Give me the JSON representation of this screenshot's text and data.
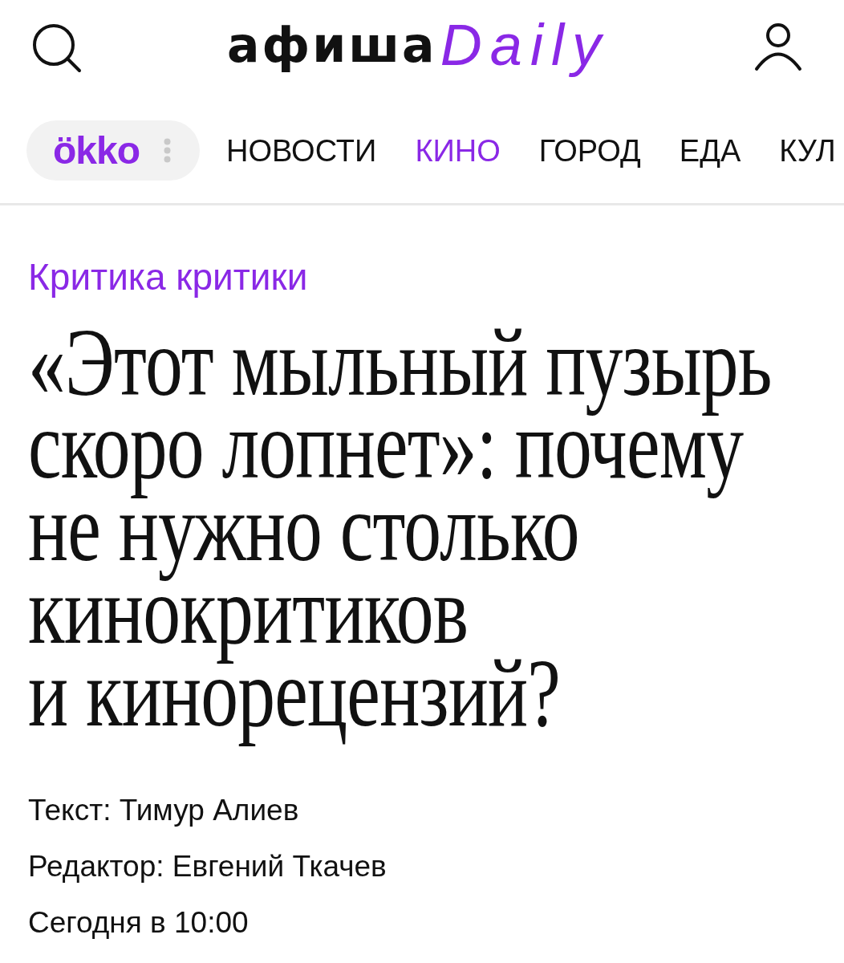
{
  "header": {
    "logo": {
      "wordmark": "афиша",
      "script": "Daily"
    }
  },
  "nav": {
    "partner": "ökko",
    "items": [
      {
        "label": "НОВОСТИ",
        "selected": false
      },
      {
        "label": "КИНО",
        "selected": true
      },
      {
        "label": "ГОРОД",
        "selected": false
      },
      {
        "label": "ЕДА",
        "selected": false
      },
      {
        "label": "КУЛ",
        "selected": false
      }
    ]
  },
  "article": {
    "rubric": "Критика критики",
    "title": "«Этот мыльный пузырь скоро лопнет»: почему не нужно столько кинокритиков и кинорецензий?",
    "credits": [
      "Текст: Тимур Алиев",
      "Редактор: Евгений Ткачев"
    ],
    "date": "Сегодня в 10:00"
  }
}
